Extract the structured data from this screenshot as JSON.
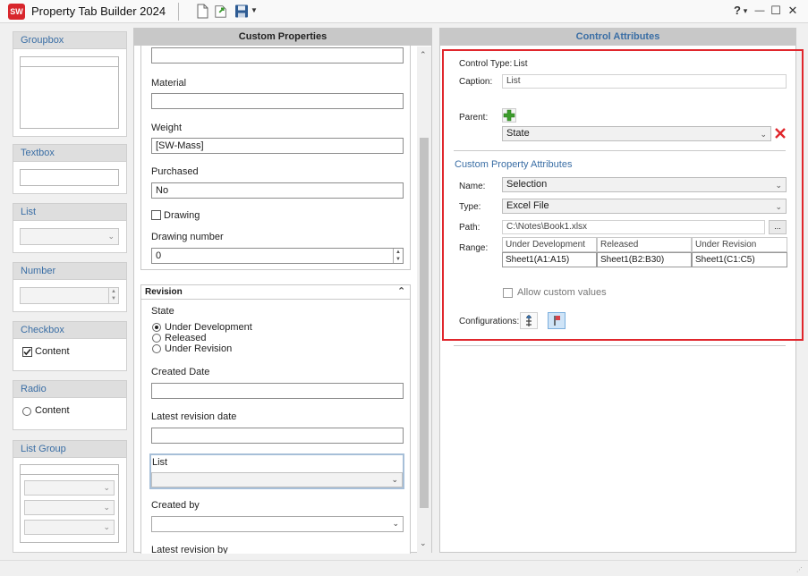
{
  "app": {
    "logo": "SW",
    "title": "Property Tab Builder   2024"
  },
  "toolbar": {
    "icons": [
      "new-file-icon",
      "open-file-icon",
      "save-icon",
      "dropdown-arrow-icon"
    ]
  },
  "window": {
    "help": "?",
    "help_arrow": "▾",
    "minimize": "—",
    "maximize": "☐",
    "close": "✕"
  },
  "palette": {
    "groupbox": "Groupbox",
    "textbox": "Textbox",
    "list": "List",
    "number": "Number",
    "checkbox": "Checkbox",
    "checkbox_content": "Content",
    "radio": "Radio",
    "radio_content": "Content",
    "list_group": "List Group"
  },
  "custom_properties": {
    "header": "Custom Properties",
    "material_label": "Material",
    "weight_label": "Weight",
    "weight_value": "[SW-Mass]",
    "purchased_label": "Purchased",
    "purchased_value": "No",
    "drawing_label": "Drawing",
    "drawing_number_label": "Drawing number",
    "drawing_number_value": "0",
    "revision": {
      "title": "Revision",
      "state_label": "State",
      "states": [
        "Under Development",
        "Released",
        "Under Revision"
      ],
      "selected_state": 0,
      "created_date_label": "Created Date",
      "latest_revision_date_label": "Latest revision date",
      "list_label": "List",
      "created_by_label": "Created by",
      "latest_revision_by_label": "Latest revision by"
    }
  },
  "control_attributes": {
    "header": "Control Attributes",
    "control_type_label": "Control Type:",
    "control_type_value": "List",
    "caption_label": "Caption:",
    "caption_value": "List",
    "parent_label": "Parent:",
    "parent_value": "State",
    "section_title": "Custom Property Attributes",
    "name_label": "Name:",
    "name_value": "Selection",
    "type_label": "Type:",
    "type_value": "Excel File",
    "path_label": "Path:",
    "path_value": "C:\\Notes\\Book1.xlsx",
    "browse_label": "...",
    "range_label": "Range:",
    "range_headers": [
      "Under Development",
      "Released",
      "Under Revision"
    ],
    "range_values": [
      "Sheet1(A1:A15)",
      "Sheet1(B2:B30)",
      "Sheet1(C1:C5)"
    ],
    "allow_custom_label": "Allow custom values",
    "configurations_label": "Configurations:"
  },
  "colors": {
    "highlight": "#e0262c",
    "accent": "#3a6ea5"
  }
}
